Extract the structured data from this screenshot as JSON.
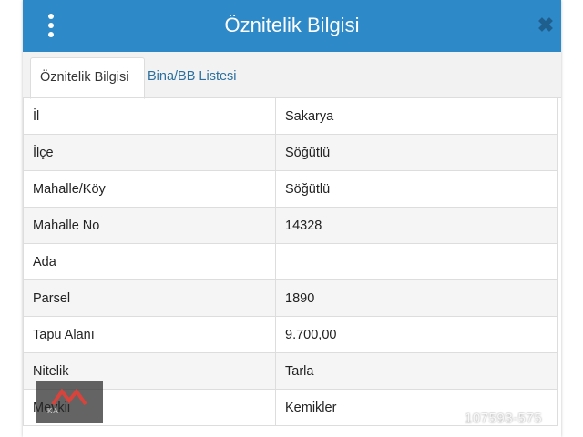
{
  "header": {
    "title": "Öznitelik Bilgisi",
    "menu_icon": "kebab-menu-icon",
    "close_icon": "close-icon"
  },
  "tabs": [
    {
      "label": "Öznitelik Bilgisi",
      "active": true
    },
    {
      "label": "Bina/BB Listesi",
      "active": false
    }
  ],
  "rows": [
    {
      "key": "İl",
      "value": "Sakarya"
    },
    {
      "key": "İlçe",
      "value": "Söğütlü"
    },
    {
      "key": "Mahalle/Köy",
      "value": "Söğütlü"
    },
    {
      "key": "Mahalle No",
      "value": "14328"
    },
    {
      "key": "Ada",
      "value": ""
    },
    {
      "key": "Parsel",
      "value": "1890"
    },
    {
      "key": "Tapu Alanı",
      "value": "9.700,00"
    },
    {
      "key": "Nitelik",
      "value": "Tarla"
    },
    {
      "key": "Mevkii",
      "value": "Kemikler"
    }
  ],
  "watermark": {
    "text": "KA",
    "logo_icon": "house-roof-logo-icon"
  },
  "listing_number": "107593-575",
  "colors": {
    "header_bg": "#2d89c8",
    "tab_link": "#2a6fa0",
    "border": "#dddddd"
  }
}
